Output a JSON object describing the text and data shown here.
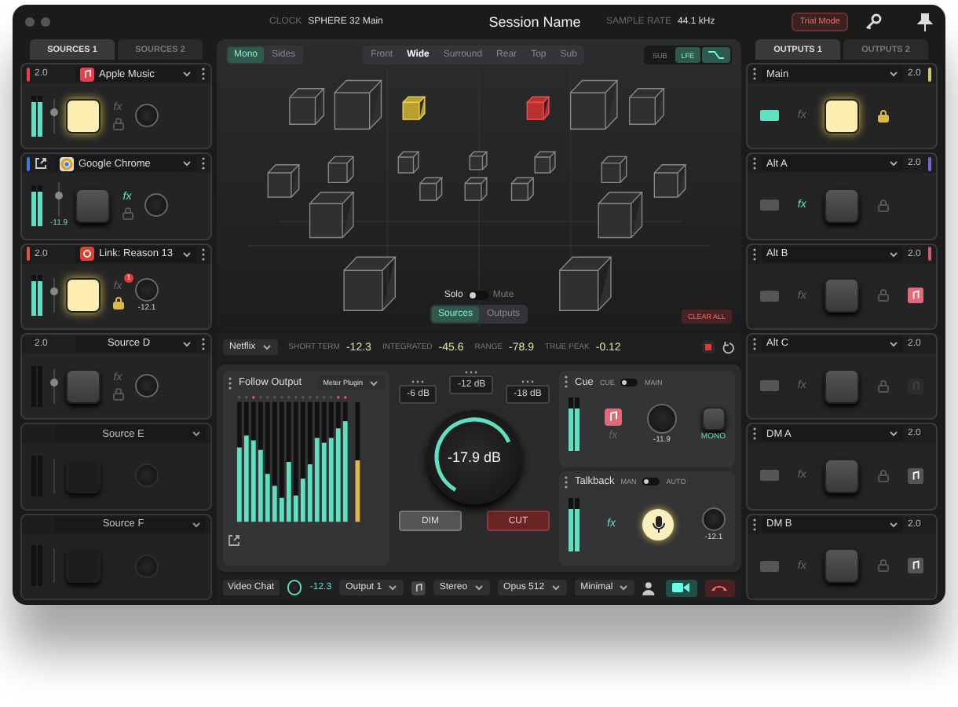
{
  "window": {
    "title": "Session Name"
  },
  "header": {
    "clock_label": "CLOCK",
    "clock_value": "SPHERE 32 Main",
    "rate_label": "SAMPLE RATE",
    "rate_value": "44.1 kHz",
    "trial_button": "Trial Mode"
  },
  "source_tabs": [
    {
      "label": "SOURCES 1",
      "selected": true
    },
    {
      "label": "SOURCES 2",
      "selected": false
    }
  ],
  "sources": [
    {
      "format": "2.0",
      "popout": false,
      "kind": "music",
      "name": "Apple Music",
      "color": "#e0424f",
      "enabled": true,
      "active": true,
      "fx_label": "fx",
      "fx_on": false,
      "locked": false,
      "level": 0.85
    },
    {
      "popout": true,
      "kind": "browser",
      "name": "Google Chrome",
      "color": "#3a7be0",
      "enabled": true,
      "active": false,
      "fx_label": "fx",
      "fx_on": true,
      "locked": false,
      "level": 0.85,
      "fader_reading": "-11.9"
    },
    {
      "format": "2.0",
      "popout": false,
      "kind": "reason",
      "name": "Link: Reason 13",
      "color": "#e0563a",
      "enabled": true,
      "active": true,
      "fx_label": "fx",
      "fx_on": false,
      "locked": true,
      "level": 0.85,
      "badge": "1",
      "knob_reading": "-12.1"
    },
    {
      "format": "2.0",
      "popout": false,
      "name": "Source D",
      "enabled": true,
      "active": false,
      "fx_label": "fx",
      "fx_on": false,
      "locked": false,
      "level": 0
    },
    {
      "popout": false,
      "name": "Source E",
      "enabled": false,
      "active": false,
      "level": 0
    },
    {
      "popout": false,
      "name": "Source F",
      "enabled": false,
      "active": false,
      "level": 0
    }
  ],
  "output_tabs": [
    {
      "label": "OUTPUTS 1",
      "selected": true
    },
    {
      "label": "OUTPUTS 2",
      "selected": false
    }
  ],
  "outputs": [
    {
      "name": "Main",
      "format": "2.0",
      "color": "#d8c86a",
      "active": true,
      "routed": true,
      "fx_label": "fx",
      "fx_on": false,
      "locked": true
    },
    {
      "name": "Alt A",
      "format": "2.0",
      "color": "#6a6ad8",
      "active": false,
      "routed": false,
      "fx_label": "fx",
      "fx_on": true,
      "locked": false
    },
    {
      "name": "Alt B",
      "format": "2.0",
      "color": "#e0566a",
      "active": false,
      "routed": false,
      "fx_label": "fx",
      "fx_on": false,
      "locked": false,
      "kind": "lit"
    },
    {
      "name": "Alt C",
      "format": "2.0",
      "active": false,
      "routed": false,
      "fx_label": "fx",
      "fx_on": false,
      "locked": false,
      "kind": "off"
    },
    {
      "name": "DM A",
      "format": "2.0",
      "active": false,
      "routed": false,
      "fx_label": "fx",
      "fx_on": false,
      "locked": false,
      "kind": "normal"
    },
    {
      "name": "DM B",
      "format": "2.0",
      "active": false,
      "routed": false,
      "fx_label": "fx",
      "fx_on": false,
      "locked": false,
      "kind": "normal"
    }
  ],
  "room": {
    "modes": [
      {
        "label": "Mono",
        "selected": true
      },
      {
        "label": "Sides",
        "selected": false
      }
    ],
    "layers": [
      {
        "label": "Front",
        "selected": false
      },
      {
        "label": "Wide",
        "selected": true
      },
      {
        "label": "Surround",
        "selected": false
      },
      {
        "label": "Rear",
        "selected": false
      },
      {
        "label": "Top",
        "selected": false
      },
      {
        "label": "Sub",
        "selected": false
      }
    ],
    "sub_lfe": [
      {
        "label": "SUB",
        "selected": false
      },
      {
        "label": "LFE",
        "selected": true
      }
    ],
    "curve_on": true,
    "solo_label": "Solo",
    "mute_label": "Mute",
    "mute": false,
    "views": [
      {
        "label": "Sources",
        "selected": true
      },
      {
        "label": "Outputs",
        "selected": false
      }
    ],
    "clear_button": "CLEAR ALL"
  },
  "loudness": {
    "preset": "Netflix",
    "metrics": [
      {
        "label": "SHORT TERM",
        "value": "-12.3"
      },
      {
        "label": "INTEGRATED",
        "value": "-45.6"
      },
      {
        "label": "RANGE",
        "value": "-78.9"
      },
      {
        "label": "TRUE PEAK",
        "value": "-0.12"
      }
    ],
    "recording": true
  },
  "meter": {
    "title": "Follow Output",
    "plugin": "Meter Plugin"
  },
  "volume": {
    "presets": [
      "-6 dB",
      "-12 dB",
      "-18 dB"
    ],
    "value": "-17.9 dB",
    "level": 0.6,
    "dim_button": "DIM",
    "dim": false,
    "cut_button": "CUT",
    "cut": true
  },
  "cue": {
    "title": "Cue",
    "switch_left": "CUE",
    "switch_right": "MAIN",
    "main": false,
    "level": 0.8,
    "fx_label": "fx",
    "knob_reading": "-11.9",
    "mono_button": "MONO",
    "mono": true
  },
  "talkback": {
    "title": "Talkback",
    "switch_left": "MAN",
    "switch_right": "AUTO",
    "auto": false,
    "level": 0.8,
    "fx_label": "fx",
    "mic_on": true,
    "knob_reading": "-12.1"
  },
  "call": {
    "app": "Video Chat",
    "value": "-12.3",
    "output": "Output 1",
    "channels": "Stereo",
    "codec": "Opus 512",
    "layout": "Minimal",
    "camera_on": true
  }
}
